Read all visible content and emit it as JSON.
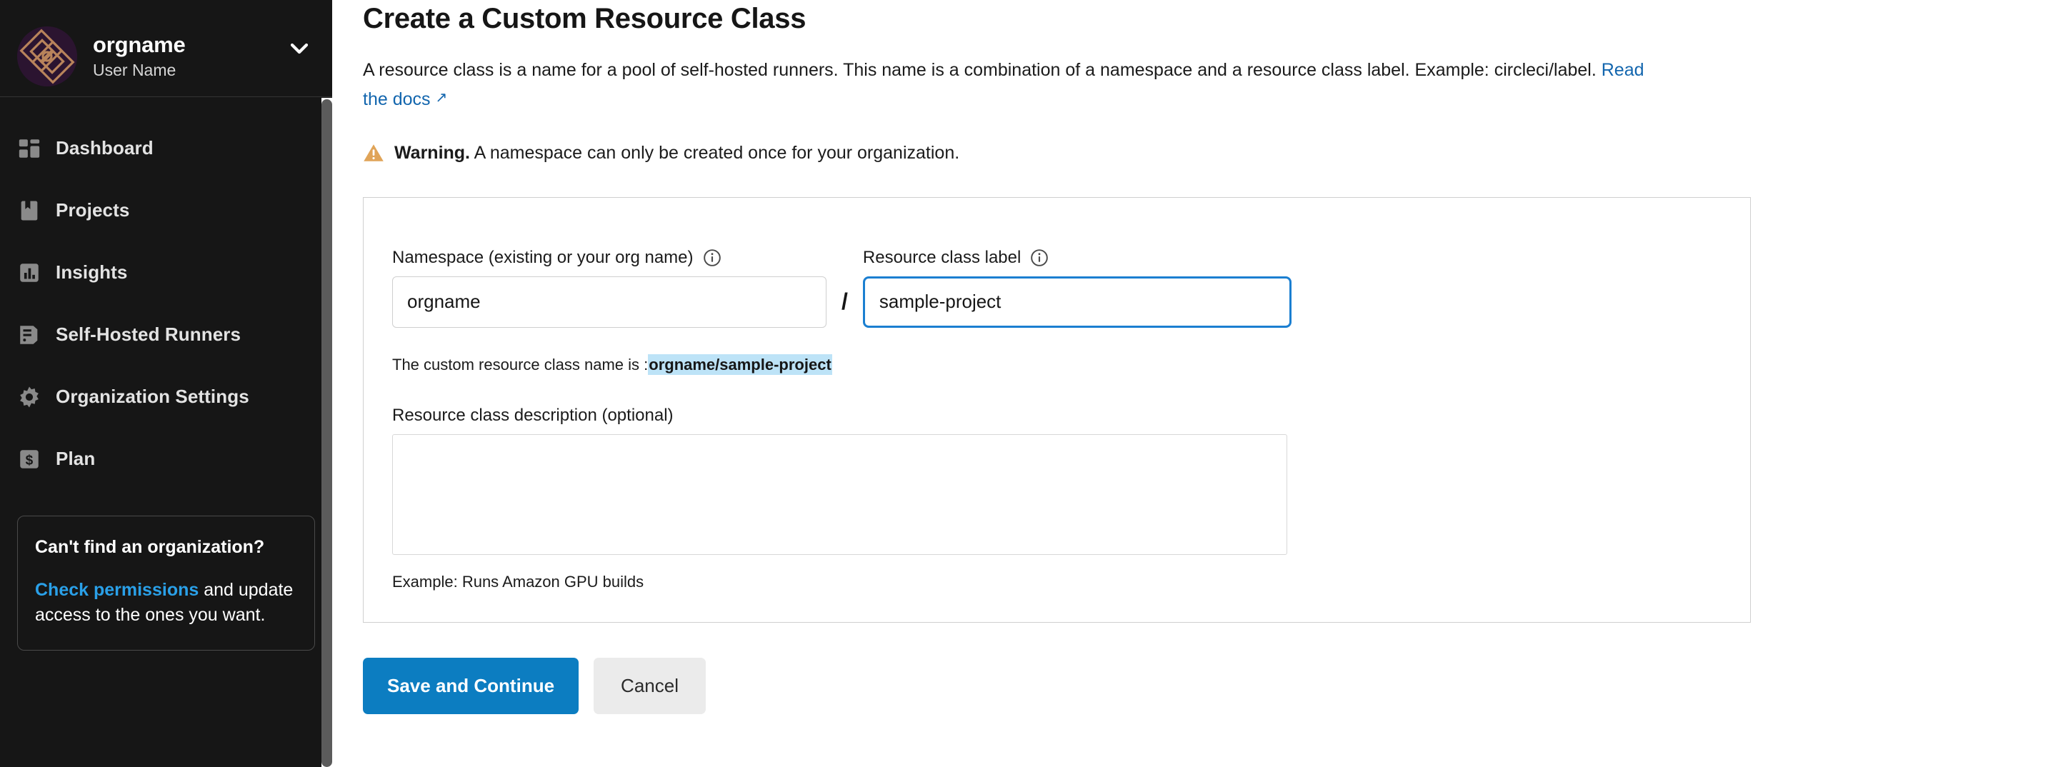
{
  "sidebar": {
    "org": {
      "name": "orgname",
      "user": "User Name",
      "avatar_bg": "#2b1430",
      "avatar_line": "#c08a5e",
      "chevron_icon": "chevron-down-icon"
    },
    "items": [
      {
        "label": "Dashboard",
        "icon": "dashboard-icon"
      },
      {
        "label": "Projects",
        "icon": "projects-bookmark-icon"
      },
      {
        "label": "Insights",
        "icon": "insights-bar-chart-icon"
      },
      {
        "label": "Self-Hosted Runners",
        "icon": "server-runner-icon"
      },
      {
        "label": "Organization Settings",
        "icon": "gear-icon"
      },
      {
        "label": "Plan",
        "icon": "dollar-icon"
      }
    ],
    "help_card": {
      "title": "Can't find an organization?",
      "link_text": "Check permissions",
      "body_text": " and update access to the ones you want.",
      "link_color": "#2aa0e8"
    }
  },
  "main": {
    "title": "Create a Custom Resource Class",
    "description_part1": "A resource class is a name for a pool of self-hosted runners. This name is a combination of a namespace and a resource class label. Example: circleci/label. ",
    "docs_link": "Read the docs",
    "docs_link_arrow": "↗",
    "warning": {
      "icon": "warning-triangle-icon",
      "strong": "Warning.",
      "text": " A namespace can only be created once for your organization.",
      "color": "#e0a458"
    },
    "form": {
      "namespace": {
        "label": "Namespace (existing or your org name)",
        "info_icon": "info-circle-icon",
        "value": "orgname",
        "placeholder": ""
      },
      "separator": "/",
      "resource_class_label": {
        "label": "Resource class label",
        "info_icon": "info-circle-icon",
        "value": "sample-project",
        "placeholder": "",
        "focused": true,
        "focus_color": "#1b7fd1"
      },
      "resolved_prefix": "The custom resource class name is :",
      "resolved_value": "orgname/sample-project",
      "resolved_highlight_color": "#bde3f7",
      "description": {
        "label": "Resource class description (optional)",
        "value": "",
        "placeholder": "",
        "example": "Example: Runs Amazon GPU builds"
      }
    },
    "buttons": {
      "save": "Save and Continue",
      "cancel": "Cancel",
      "save_color": "#0c7dc1",
      "cancel_color": "#ebebeb"
    }
  }
}
